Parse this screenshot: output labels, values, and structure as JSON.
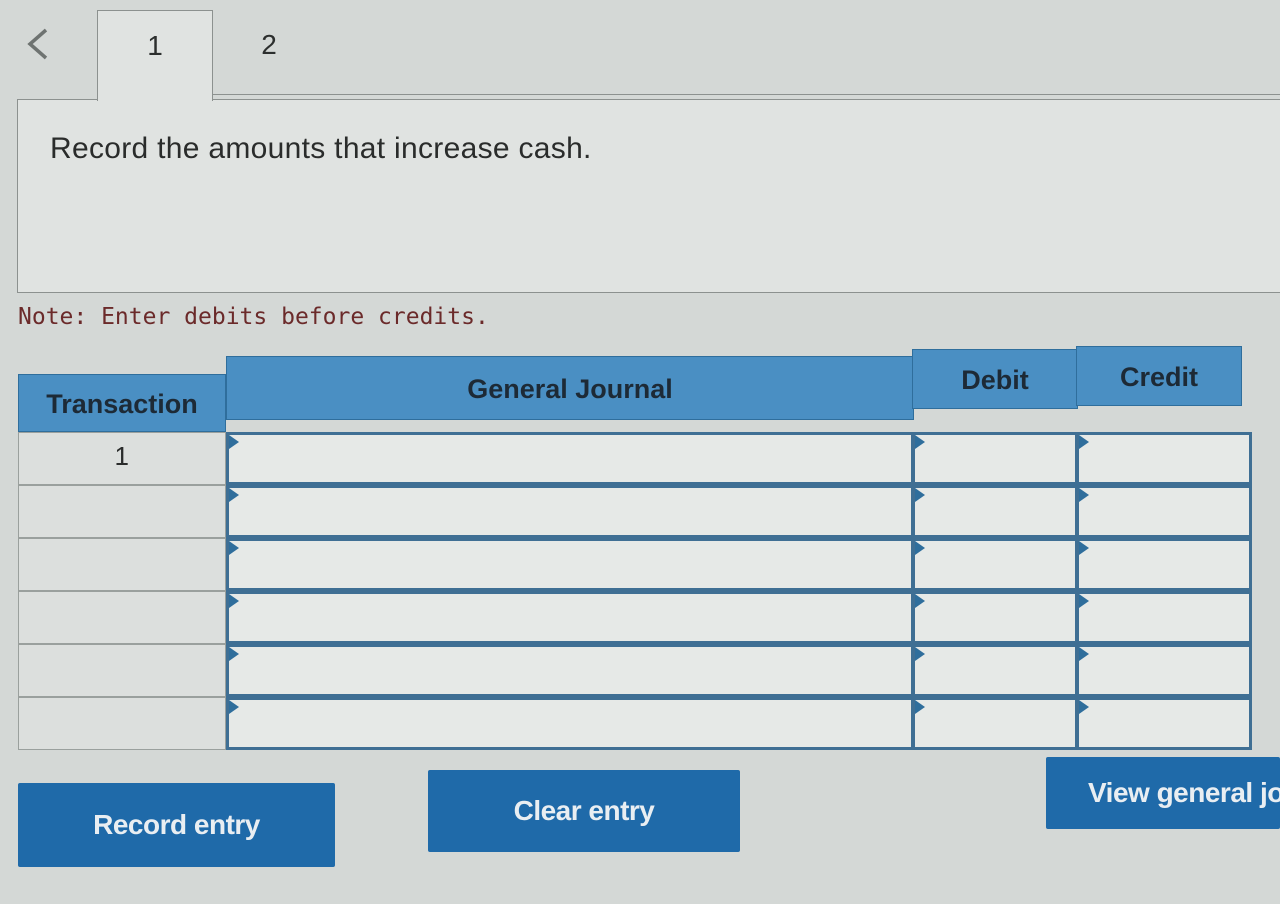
{
  "tabs": {
    "back_icon": "chevron-left-icon",
    "items": [
      {
        "label": "1",
        "active": true
      },
      {
        "label": "2",
        "active": false
      }
    ]
  },
  "prompt": {
    "text": "Record the amounts that increase cash."
  },
  "note": {
    "text": "Note: Enter debits before credits."
  },
  "journal": {
    "headers": {
      "transaction": "Transaction",
      "general_journal": "General Journal",
      "debit": "Debit",
      "credit": "Credit"
    },
    "rows": [
      {
        "transaction": "1",
        "account": "",
        "debit": "",
        "credit": ""
      },
      {
        "transaction": "",
        "account": "",
        "debit": "",
        "credit": ""
      },
      {
        "transaction": "",
        "account": "",
        "debit": "",
        "credit": ""
      },
      {
        "transaction": "",
        "account": "",
        "debit": "",
        "credit": ""
      },
      {
        "transaction": "",
        "account": "",
        "debit": "",
        "credit": ""
      },
      {
        "transaction": "",
        "account": "",
        "debit": "",
        "credit": ""
      }
    ]
  },
  "buttons": {
    "record": "Record entry",
    "clear": "Clear entry",
    "view": "View general jo"
  },
  "colors": {
    "header_blue": "#4a8fc3",
    "button_blue": "#1f6aa9",
    "note_red": "#6b2a2a"
  }
}
